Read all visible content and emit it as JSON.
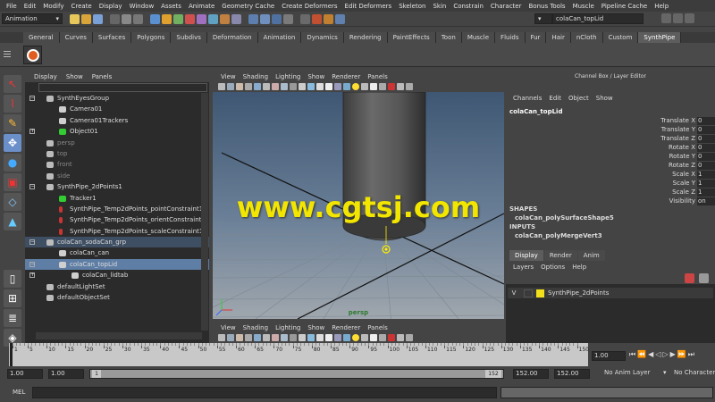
{
  "menubar": [
    "File",
    "Edit",
    "Modify",
    "Create",
    "Display",
    "Window",
    "Assets",
    "Animate",
    "Geometry Cache",
    "Create Deformers",
    "Edit Deformers",
    "Skeleton",
    "Skin",
    "Constrain",
    "Character",
    "Bonus Tools",
    "Muscle",
    "Pipeline Cache",
    "Help"
  ],
  "statusline": {
    "mode": "Animation",
    "selected_object": "colaCan_topLid"
  },
  "shelf": {
    "tabs": [
      "General",
      "Curves",
      "Surfaces",
      "Polygons",
      "Subdivs",
      "Deformation",
      "Animation",
      "Dynamics",
      "Rendering",
      "PaintEffects",
      "Toon",
      "Muscle",
      "Fluids",
      "Fur",
      "Hair",
      "nCloth",
      "Custom",
      "SynthPipe"
    ],
    "active": "SynthPipe"
  },
  "outliner": {
    "menu": [
      "Display",
      "Show",
      "Panels"
    ],
    "items": [
      {
        "label": "SynthEyesGroup",
        "indent": 1
      },
      {
        "label": "Camera01",
        "indent": 2
      },
      {
        "label": "Camera01Trackers",
        "indent": 2
      },
      {
        "label": "Object01",
        "indent": 2
      },
      {
        "label": "persp",
        "indent": 1
      },
      {
        "label": "top",
        "indent": 1
      },
      {
        "label": "front",
        "indent": 1
      },
      {
        "label": "side",
        "indent": 1
      },
      {
        "label": "SynthPipe_2dPoints1",
        "indent": 1
      },
      {
        "label": "Tracker1",
        "indent": 2
      },
      {
        "label": "SynthPipe_Temp2dPoints_pointConstraint1",
        "indent": 2
      },
      {
        "label": "SynthPipe_Temp2dPoints_orientConstraint1",
        "indent": 2
      },
      {
        "label": "SynthPipe_Temp2dPoints_scaleConstraint1",
        "indent": 2
      },
      {
        "label": "colaCan_sodaCan_grp",
        "indent": 1
      },
      {
        "label": "colaCan_can",
        "indent": 2
      },
      {
        "label": "colaCan_topLid",
        "indent": 2
      },
      {
        "label": "colaCan_lidtab",
        "indent": 3
      },
      {
        "label": "defaultLightSet",
        "indent": 1
      },
      {
        "label": "defaultObjectSet",
        "indent": 1
      }
    ]
  },
  "viewport": {
    "menu": [
      "View",
      "Shading",
      "Lighting",
      "Show",
      "Renderer",
      "Panels"
    ],
    "camera_label": "persp",
    "watermark": "www.cgtsj.com"
  },
  "channel_box": {
    "title": "Channel Box / Layer Editor",
    "menu": [
      "Channels",
      "Edit",
      "Object",
      "Show"
    ],
    "object_name": "colaCan_topLid",
    "attributes": [
      {
        "name": "Translate X",
        "value": "0"
      },
      {
        "name": "Translate Y",
        "value": "0"
      },
      {
        "name": "Translate Z",
        "value": "0"
      },
      {
        "name": "Rotate X",
        "value": "0"
      },
      {
        "name": "Rotate Y",
        "value": "0"
      },
      {
        "name": "Rotate Z",
        "value": "0"
      },
      {
        "name": "Scale X",
        "value": "1"
      },
      {
        "name": "Scale Y",
        "value": "1"
      },
      {
        "name": "Scale Z",
        "value": "1"
      },
      {
        "name": "Visibility",
        "value": "on"
      }
    ],
    "shapes_header": "SHAPES",
    "shape_node": "colaCan_polySurfaceShape5",
    "inputs_header": "INPUTS",
    "input_node": "colaCan_polyMergeVert3"
  },
  "layer_editor": {
    "tabs": [
      "Display",
      "Render",
      "Anim"
    ],
    "active": "Display",
    "menu": [
      "Layers",
      "Options",
      "Help"
    ],
    "layer": {
      "visible": "V",
      "name": "SynthPipe_2dPoints",
      "color": "#f2e01a"
    }
  },
  "timeslider": {
    "ticks": [
      "1",
      "5",
      "10",
      "15",
      "20",
      "25",
      "30",
      "35",
      "40",
      "45",
      "50",
      "55",
      "60",
      "65",
      "70",
      "75",
      "80",
      "85",
      "90",
      "95",
      "100",
      "105",
      "110",
      "115",
      "120",
      "125",
      "130",
      "135",
      "140",
      "145",
      "150"
    ],
    "current_frame": "1.00"
  },
  "range": {
    "start": "1.00",
    "playback_start": "1.00",
    "slider_start": "1",
    "slider_end": "152",
    "playback_end": "152.00",
    "end": "152.00",
    "anim_layer": "No Anim Layer",
    "character_set": "No Character S"
  },
  "command_line": {
    "label": "MEL"
  },
  "colors": {
    "selection": "#5f7ea5",
    "accent_yellow": "#f2e01a",
    "watermark": "#f2e600"
  }
}
